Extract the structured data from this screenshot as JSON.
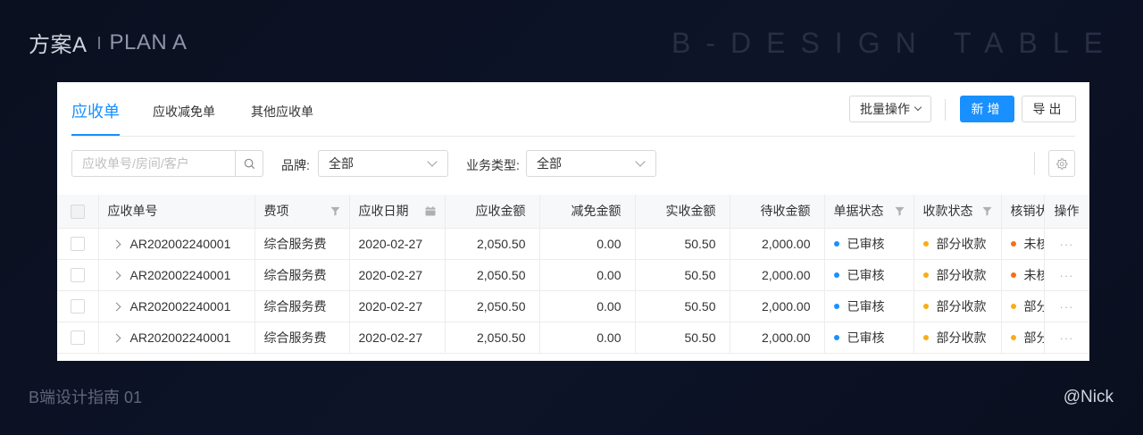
{
  "header": {
    "title_cn": "方案A",
    "title_en": "PLAN A",
    "right_title": "B-DESIGN TABLE"
  },
  "footer": {
    "left": "B端设计指南 01",
    "right": "@Nick"
  },
  "tabs": [
    {
      "label": "应收单",
      "active": true
    },
    {
      "label": "应收减免单",
      "active": false
    },
    {
      "label": "其他应收单",
      "active": false
    }
  ],
  "toolbar": {
    "batch_label": "批量操作",
    "new_label": "新增",
    "export_label": "导出"
  },
  "filters": {
    "search_placeholder": "应收单号/房间/客户",
    "brand_label": "品牌:",
    "brand_value": "全部",
    "biztype_label": "业务类型:",
    "biztype_value": "全部"
  },
  "table": {
    "columns": [
      "应收单号",
      "费项",
      "应收日期",
      "应收金额",
      "减免金额",
      "实收金额",
      "待收金额",
      "单据状态",
      "收款状态",
      "核销状态",
      "操作"
    ],
    "rows": [
      {
        "no": "AR202002240001",
        "item": "综合服务费",
        "date": "2020-02-27",
        "receivable": "2,050.50",
        "reduction": "0.00",
        "received": "50.50",
        "pending": "2,000.00",
        "doc_status": "已审核",
        "pay_status": "部分收款",
        "verify_status": "未核销",
        "action": "···"
      },
      {
        "no": "AR202002240001",
        "item": "综合服务费",
        "date": "2020-02-27",
        "receivable": "2,050.50",
        "reduction": "0.00",
        "received": "50.50",
        "pending": "2,000.00",
        "doc_status": "已审核",
        "pay_status": "部分收款",
        "verify_status": "未核销",
        "action": "···"
      },
      {
        "no": "AR202002240001",
        "item": "综合服务费",
        "date": "2020-02-27",
        "receivable": "2,050.50",
        "reduction": "0.00",
        "received": "50.50",
        "pending": "2,000.00",
        "doc_status": "已审核",
        "pay_status": "部分收款",
        "verify_status": "部分核销",
        "action": "···"
      },
      {
        "no": "AR202002240001",
        "item": "综合服务费",
        "date": "2020-02-27",
        "receivable": "2,050.50",
        "reduction": "0.00",
        "received": "50.50",
        "pending": "2,000.00",
        "doc_status": "已审核",
        "pay_status": "部分收款",
        "verify_status": "部分核销",
        "action": "···"
      }
    ]
  },
  "colors": {
    "primary": "#1890ff",
    "status_approved": "#1890ff",
    "status_partial_paid": "#faad14",
    "status_unverified": "#fa6d14",
    "status_partial_verified": "#faad14"
  },
  "icons": {
    "search": "search-icon",
    "gear": "gear-icon",
    "filter": "filter-icon",
    "calendar": "calendar-icon",
    "expand": "chevron-right-icon",
    "dropdown": "chevron-down-icon"
  }
}
